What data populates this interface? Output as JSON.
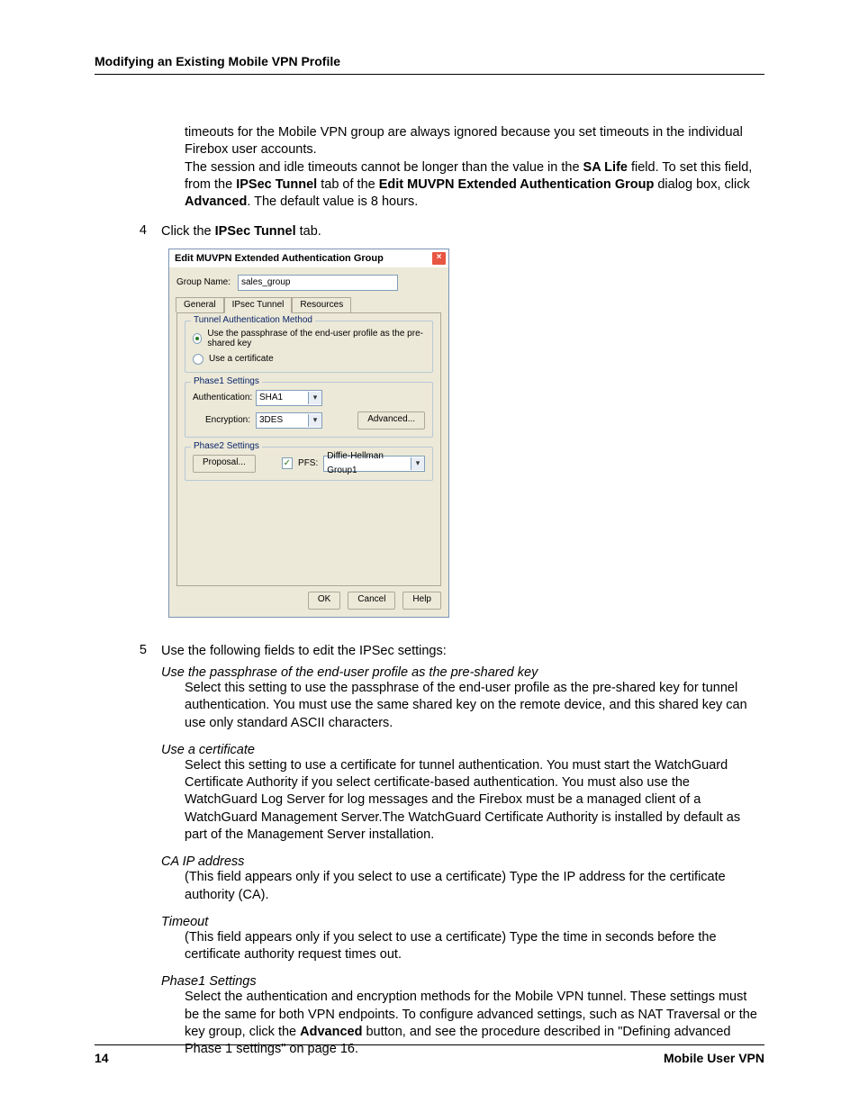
{
  "header": {
    "title": "Modifying an Existing Mobile VPN Profile"
  },
  "intro": {
    "para1": "timeouts for the Mobile VPN group are always ignored because you set timeouts in the individual Firebox user accounts.",
    "para2a": "The session and idle timeouts cannot be longer than the value in the ",
    "sa_life": "SA Life",
    "para2b": " field. To set this field, from the ",
    "ipsec_tunnel1": "IPSec Tunnel",
    "para2c": " tab of the ",
    "edit_group": "Edit MUVPN Extended Authentication Group",
    "para2d": " dialog box, click ",
    "advanced": "Advanced",
    "para2e": ". The default value is 8 hours."
  },
  "step4": {
    "num": "4",
    "a": "Click the ",
    "b": "IPSec Tunnel",
    "c": " tab."
  },
  "dialog": {
    "title": "Edit MUVPN Extended Authentication Group",
    "group_name_label": "Group Name:",
    "group_name_value": "sales_group",
    "tabs": {
      "general": "General",
      "ipsec": "IPsec Tunnel",
      "resources": "Resources"
    },
    "fs_auth": {
      "legend": "Tunnel Authentication Method",
      "opt1": "Use the passphrase of the end-user profile as the pre-shared key",
      "opt2": "Use a certificate"
    },
    "fs_p1": {
      "legend": "Phase1 Settings",
      "auth_lbl": "Authentication:",
      "auth_val": "SHA1",
      "enc_lbl": "Encryption:",
      "enc_val": "3DES",
      "adv_btn": "Advanced..."
    },
    "fs_p2": {
      "legend": "Phase2 Settings",
      "proposal_btn": "Proposal...",
      "pfs_lbl": "PFS:",
      "dh_val": "Diffie-Hellman Group1"
    },
    "buttons": {
      "ok": "OK",
      "cancel": "Cancel",
      "help": "Help"
    }
  },
  "step5": {
    "num": "5",
    "text": "Use the following fields to edit the IPSec settings:"
  },
  "defs": {
    "passphrase": {
      "title": "Use the passphrase of the end-user profile as the pre-shared key",
      "body": "Select this setting to use the passphrase of the end-user profile as the pre-shared key for tunnel authentication. You must use the same shared key on the remote device, and this shared key can use only standard ASCII characters."
    },
    "cert": {
      "title": "Use a certificate",
      "body": "Select this setting to use a certificate for tunnel authentication. You must start the WatchGuard Certificate Authority if you select certificate-based authentication. You must also use the WatchGuard Log Server for log messages and the Firebox must be a managed client of a WatchGuard Management Server.The WatchGuard Certificate Authority is installed by default as part of the Management Server installation."
    },
    "caip": {
      "title": "CA IP address",
      "body": "(This field appears only if you select to use a certificate) Type the IP address for the certificate authority (CA)."
    },
    "timeout": {
      "title": "Timeout",
      "body": "(This field appears only if you select to use a certificate) Type the time in seconds before the certificate authority request times out."
    },
    "p1": {
      "title": "Phase1 Settings",
      "body_a": "Select the authentication and encryption methods for the Mobile VPN tunnel. These settings must be the same for both VPN endpoints. To configure advanced settings, such as NAT Traversal or the key group, click the ",
      "adv": "Advanced",
      "body_b": " button, and see the procedure described in \"Defining advanced Phase 1 settings\" on page 16."
    }
  },
  "footer": {
    "page": "14",
    "right": "Mobile User VPN"
  }
}
